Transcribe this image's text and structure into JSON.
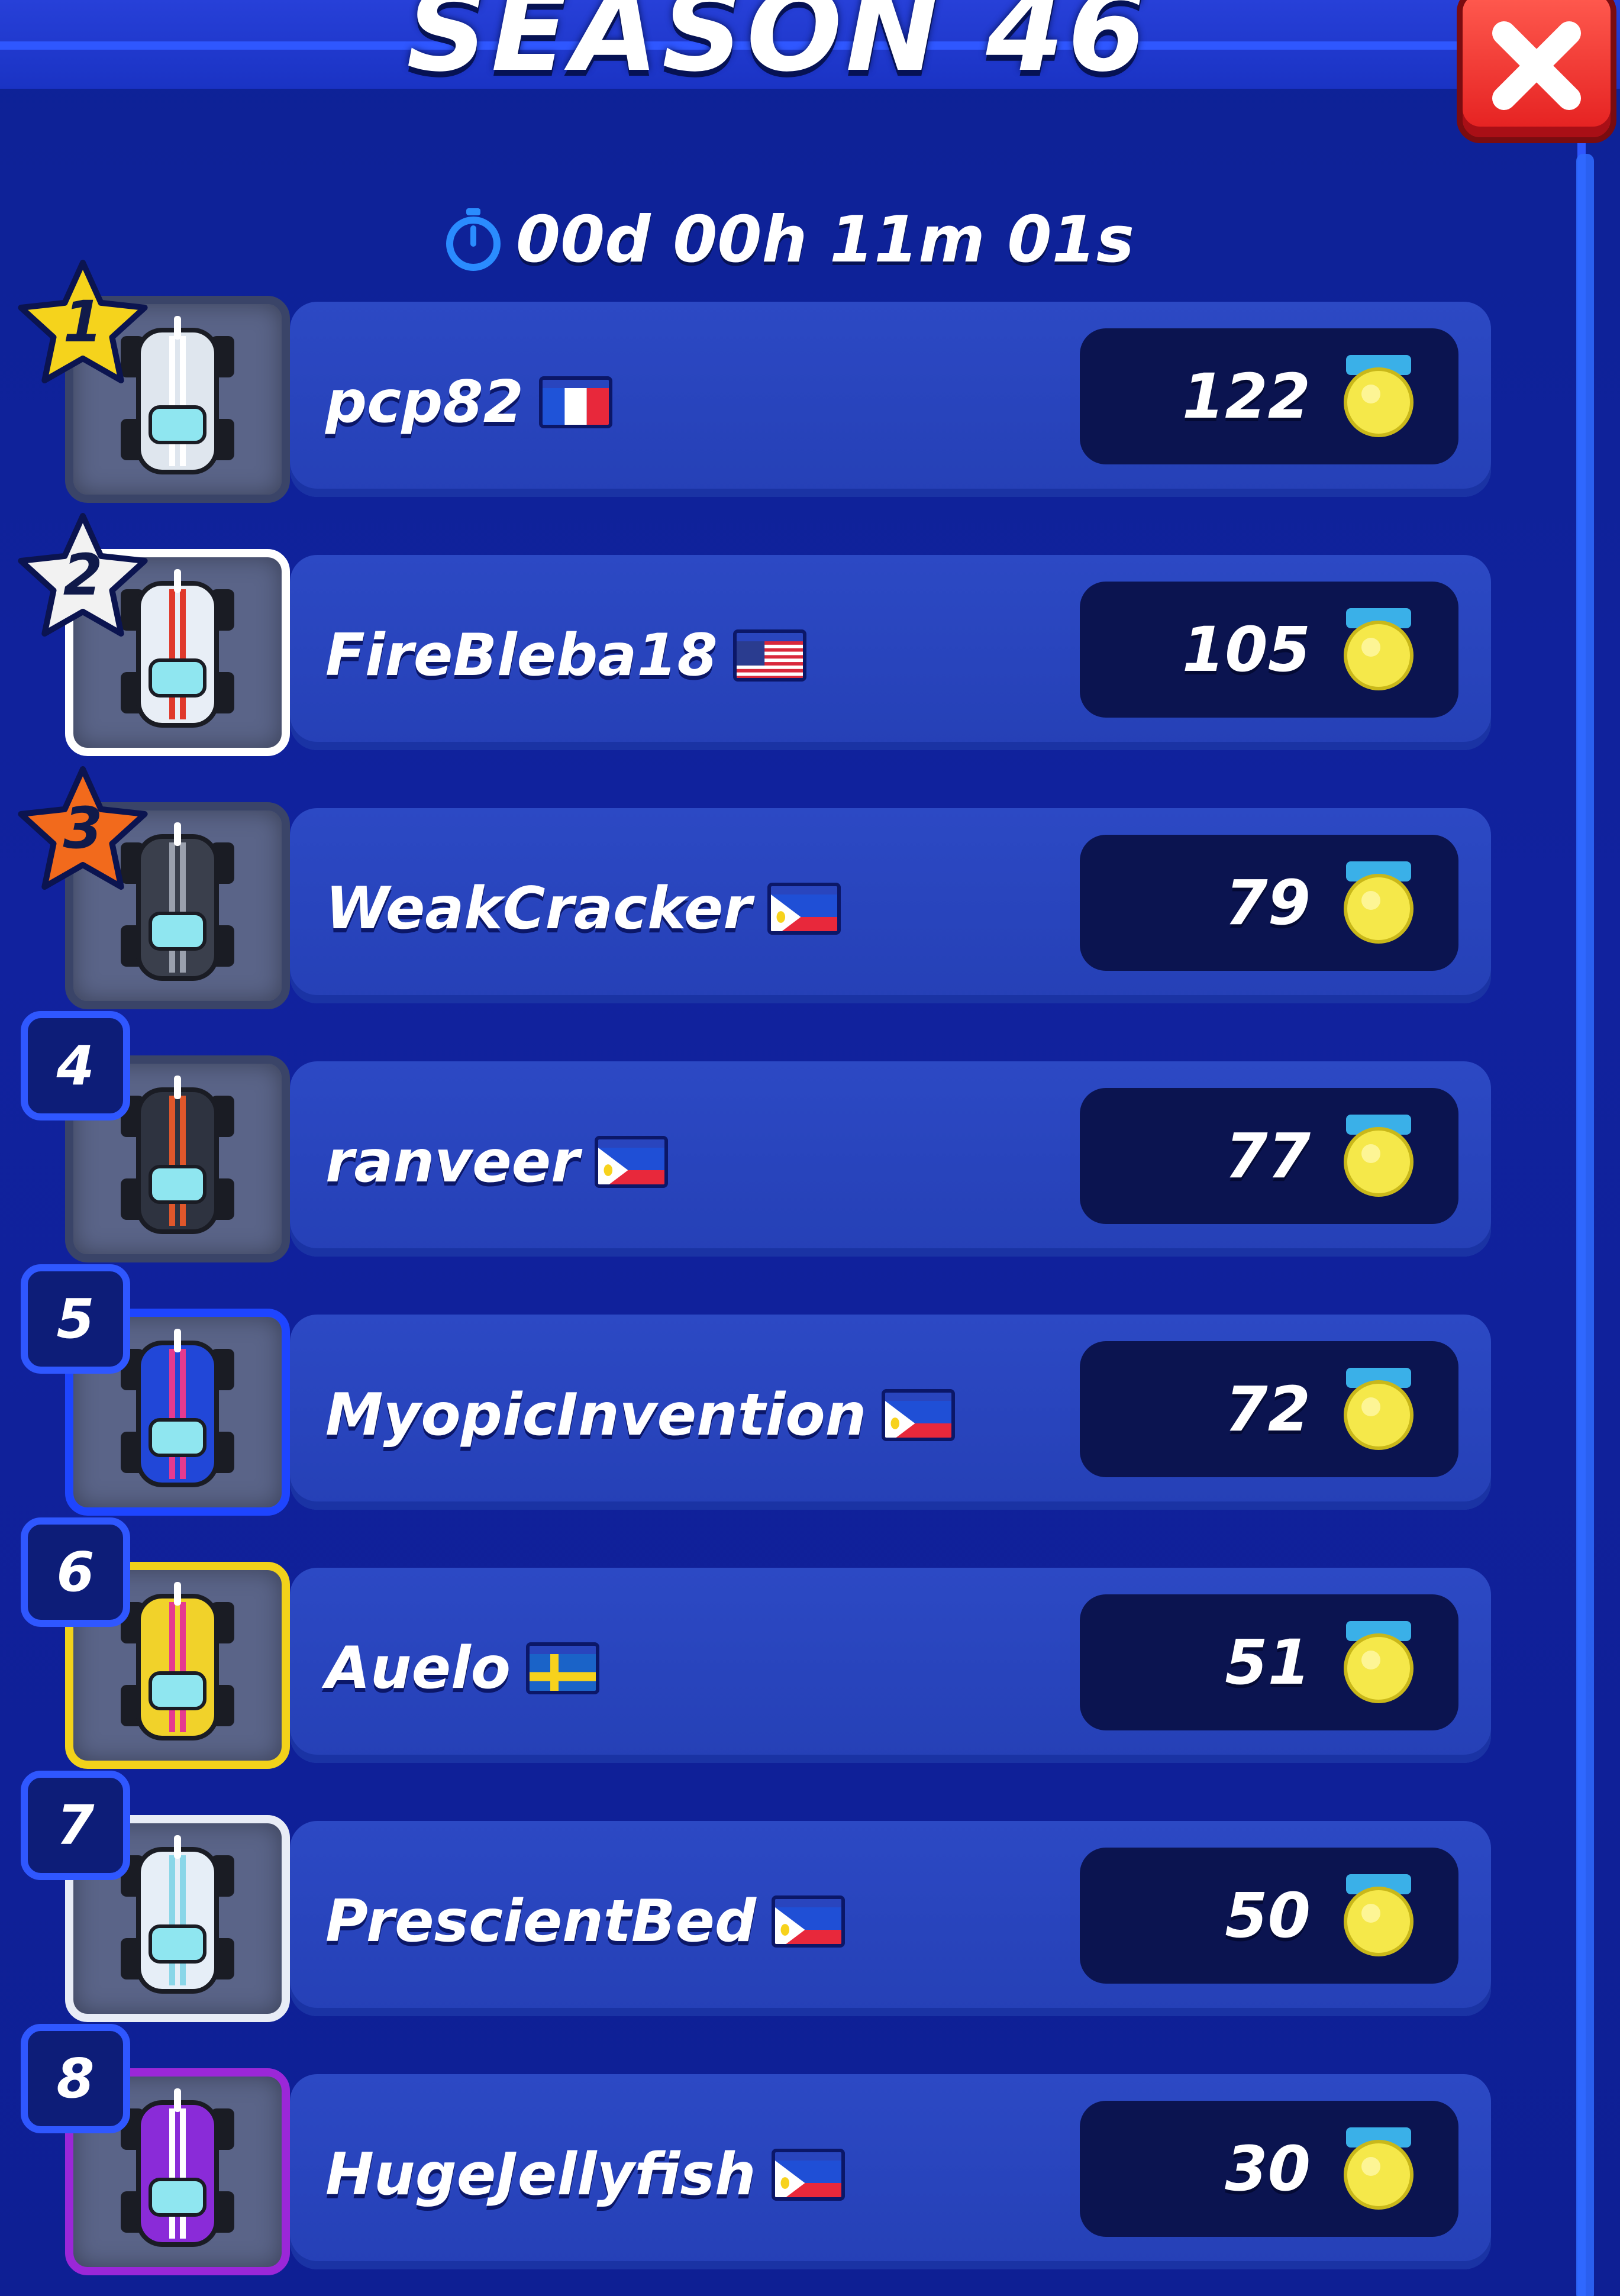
{
  "header": {
    "title": "SEASON 46"
  },
  "timer": {
    "text": "00d 00h 11m 01s",
    "icon": "stopwatch-icon"
  },
  "close_button": {
    "icon": "close-icon",
    "color": "#e41f1f"
  },
  "leaderboard": [
    {
      "rank": "1",
      "name": "pcp82",
      "flag": "France",
      "score": "122",
      "frame": "#3a4468",
      "badge": "gold-star"
    },
    {
      "rank": "2",
      "name": "FireBleba18",
      "flag": "USA",
      "score": "105",
      "frame": "#ffffff",
      "badge": "silver-star"
    },
    {
      "rank": "3",
      "name": "WeakCracker",
      "flag": "Philippines",
      "score": "79",
      "frame": "#3a4468",
      "badge": "bronze-star"
    },
    {
      "rank": "4",
      "name": "ranveer",
      "flag": "Philippines",
      "score": "77",
      "frame": "#3a4468",
      "badge": "box"
    },
    {
      "rank": "5",
      "name": "MyopicInvention",
      "flag": "Philippines",
      "score": "72",
      "frame": "#1e45ff",
      "badge": "box"
    },
    {
      "rank": "6",
      "name": "Auelo",
      "flag": "Sweden",
      "score": "51",
      "frame": "#f2d21a",
      "badge": "box"
    },
    {
      "rank": "7",
      "name": "PrescientBed",
      "flag": "Philippines",
      "score": "50",
      "frame": "#e8ecf6",
      "badge": "box"
    },
    {
      "rank": "8",
      "name": "HugeJellyfish",
      "flag": "Philippines",
      "score": "30",
      "frame": "#9b27d8",
      "badge": "box"
    }
  ],
  "colors": {
    "background": "#11229e",
    "row": "#2540b6",
    "score_box": "#0b1450",
    "gold": "#f5d31c",
    "silver": "#f2f2f2",
    "bronze": "#f26a1c",
    "trophy": "#f5e84a"
  }
}
